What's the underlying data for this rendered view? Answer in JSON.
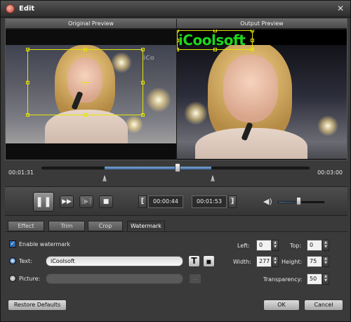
{
  "window": {
    "title": "Edit"
  },
  "preview": {
    "original_label": "Original Preview",
    "output_label": "Output Preview",
    "watermark_overlay_text": "iCoolsoft",
    "ghost_watermark_text": "iCo"
  },
  "timeline": {
    "current_time": "00:01:31",
    "total_time": "00:03:00",
    "position_fraction": 0.505,
    "start_marker_fraction": 0.235,
    "end_marker_fraction": 0.635
  },
  "controls": {
    "start_time": "00:00:44",
    "end_time": "00:01:53",
    "volume_fraction": 0.5
  },
  "tabs": [
    {
      "label": "Effect",
      "active": false
    },
    {
      "label": "Trim",
      "active": false
    },
    {
      "label": "Crop",
      "active": false
    },
    {
      "label": "Watermark",
      "active": true
    }
  ],
  "watermark": {
    "enable_label": "Enable watermark",
    "enabled": true,
    "text_label": "Text:",
    "text_value": "iCoolsoft",
    "picture_label": "Picture:",
    "browse_label": "...",
    "left_label": "Left:",
    "left_value": "0",
    "top_label": "Top:",
    "top_value": "0",
    "width_label": "Width:",
    "width_value": "277",
    "height_label": "Height:",
    "height_value": "75",
    "transparency_label": "Transparency:",
    "transparency_value": "50"
  },
  "footer": {
    "restore_label": "Restore Defaults",
    "ok_label": "OK",
    "cancel_label": "Cancel"
  },
  "colors": {
    "watermark_text": "#1fd61f",
    "crop_box": "#e6e600",
    "accent": "#3b6fa8"
  }
}
